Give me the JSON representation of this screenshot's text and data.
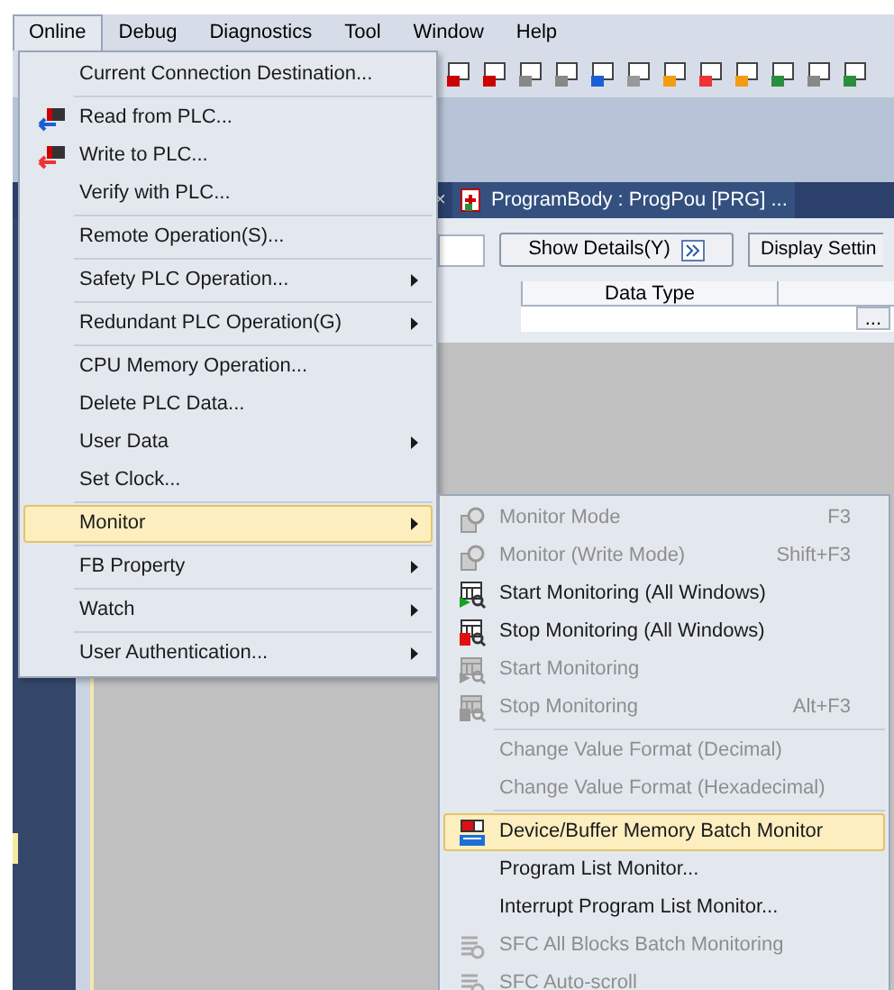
{
  "menu_bar": [
    {
      "label": "Online",
      "selected": true
    },
    {
      "label": "Debug",
      "selected": false
    },
    {
      "label": "Diagnostics",
      "selected": false
    },
    {
      "label": "Tool",
      "selected": false
    },
    {
      "label": "Window",
      "selected": false
    },
    {
      "label": "Help",
      "selected": false
    }
  ],
  "online_menu": {
    "items": [
      {
        "kind": "item",
        "label": "Current Connection Destination...",
        "submenu": false,
        "selected": false
      },
      {
        "kind": "separator"
      },
      {
        "kind": "item",
        "label": "Read from PLC...",
        "submenu": false,
        "selected": false
      },
      {
        "kind": "item",
        "label": "Write to PLC...",
        "submenu": false,
        "selected": false
      },
      {
        "kind": "item",
        "label": "Verify with PLC...",
        "submenu": false,
        "selected": false
      },
      {
        "kind": "separator"
      },
      {
        "kind": "item",
        "label": "Remote Operation(S)...",
        "submenu": false,
        "selected": false
      },
      {
        "kind": "separator"
      },
      {
        "kind": "item",
        "label": "Safety PLC Operation...",
        "submenu": true,
        "selected": false
      },
      {
        "kind": "separator"
      },
      {
        "kind": "item",
        "label": "Redundant PLC Operation(G)",
        "submenu": true,
        "selected": false
      },
      {
        "kind": "separator"
      },
      {
        "kind": "item",
        "label": "CPU Memory Operation...",
        "submenu": false,
        "selected": false
      },
      {
        "kind": "item",
        "label": "Delete PLC Data...",
        "submenu": false,
        "selected": false
      },
      {
        "kind": "item",
        "label": "User Data",
        "submenu": true,
        "selected": false
      },
      {
        "kind": "item",
        "label": "Set Clock...",
        "submenu": false,
        "selected": false
      },
      {
        "kind": "separator"
      },
      {
        "kind": "item",
        "label": "Monitor",
        "submenu": true,
        "selected": true
      },
      {
        "kind": "separator"
      },
      {
        "kind": "item",
        "label": "FB Property",
        "submenu": true,
        "selected": false
      },
      {
        "kind": "separator"
      },
      {
        "kind": "item",
        "label": "Watch",
        "submenu": true,
        "selected": false
      },
      {
        "kind": "separator"
      },
      {
        "kind": "item",
        "label": "User Authentication...",
        "submenu": true,
        "selected": false
      }
    ]
  },
  "monitor_submenu": {
    "items": [
      {
        "kind": "item",
        "label": "Monitor Mode",
        "shortcut": "F3",
        "disabled": true,
        "selected": false
      },
      {
        "kind": "item",
        "label": "Monitor (Write Mode)",
        "shortcut": "Shift+F3",
        "disabled": true,
        "selected": false
      },
      {
        "kind": "item",
        "label": "Start Monitoring (All Windows)",
        "disabled": false,
        "selected": false
      },
      {
        "kind": "item",
        "label": "Stop Monitoring (All Windows)",
        "disabled": false,
        "selected": false
      },
      {
        "kind": "item",
        "label": "Start Monitoring",
        "disabled": true,
        "selected": false
      },
      {
        "kind": "item",
        "label": "Stop Monitoring",
        "shortcut": "Alt+F3",
        "disabled": true,
        "selected": false
      },
      {
        "kind": "separator"
      },
      {
        "kind": "item",
        "label": "Change Value Format (Decimal)",
        "disabled": true,
        "selected": false
      },
      {
        "kind": "item",
        "label": "Change Value Format (Hexadecimal)",
        "disabled": true,
        "selected": false
      },
      {
        "kind": "separator"
      },
      {
        "kind": "item",
        "label": "Device/Buffer Memory Batch Monitor",
        "disabled": false,
        "selected": true
      },
      {
        "kind": "item",
        "label": "Program List Monitor...",
        "disabled": false,
        "selected": false
      },
      {
        "kind": "item",
        "label": "Interrupt Program List Monitor...",
        "disabled": false,
        "selected": false
      },
      {
        "kind": "item",
        "label": "SFC All Blocks Batch Monitoring",
        "disabled": true,
        "selected": false
      },
      {
        "kind": "item",
        "label": "SFC Auto-scroll",
        "disabled": true,
        "selected": false
      }
    ]
  },
  "editor_tab": {
    "close": "×",
    "title": "ProgramBody : ProgPou [PRG] ..."
  },
  "buttons": [
    "Show Details(Y)",
    "Display Settin"
  ],
  "table": {
    "columns": [
      "Data Type"
    ],
    "row_button": "..."
  }
}
